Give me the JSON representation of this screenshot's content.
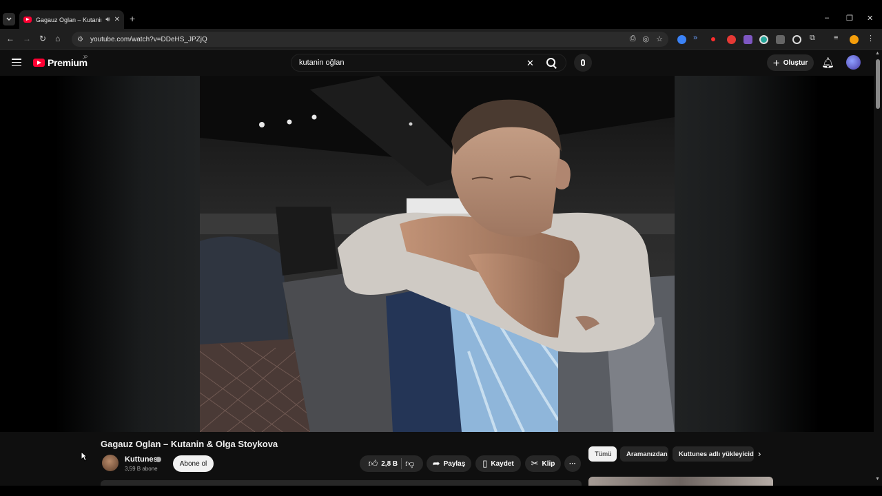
{
  "browser": {
    "tab_title": "Gagauz Oglan – Kutanin & Olga Stoykova",
    "audio_icon": "speaker-icon",
    "url": "youtube.com/watch?v=DDeHS_JPZjQ",
    "window_controls": [
      "–",
      "❐",
      "✕"
    ]
  },
  "youtube": {
    "logo_text": "Premium",
    "region": "JP",
    "search_query": "kutanin oğlan",
    "create_label": "Oluştur"
  },
  "video": {
    "title": "Gagauz Oglan – Kutanin & Olga Stoykova",
    "channel_name": "Kuttunes",
    "subscribers": "3,59 B abone",
    "subscribe_label": "Abone ol",
    "likes": "2,8 B",
    "share_label": "Paylaş",
    "save_label": "Kaydet",
    "clip_label": "Klip",
    "more_label": "···"
  },
  "sidebar": {
    "chips": [
      "Tümü",
      "Aramanızdan",
      "Kuttunes adlı yükleyiciden"
    ]
  }
}
